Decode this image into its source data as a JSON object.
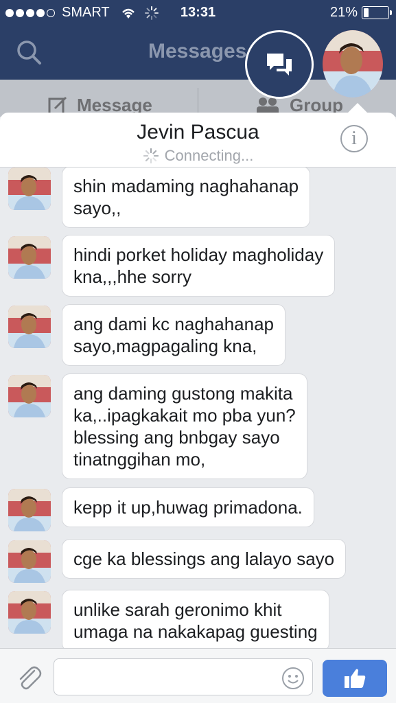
{
  "status_bar": {
    "carrier": "SMART",
    "time": "13:31",
    "battery": "21%",
    "battery_level": 0.21,
    "signal_bars_filled": 4,
    "signal_bars_total": 5
  },
  "nav": {
    "title": "Messages",
    "search_icon": "search-icon"
  },
  "composer": {
    "message_label": "Message",
    "group_label": "Group"
  },
  "chat": {
    "contact_name": "Jevin Pascua",
    "status": "Connecting...",
    "info_icon": "info-icon"
  },
  "messages": [
    {
      "text": "shin madaming naghahanap\nsayo,,"
    },
    {
      "text": "hindi porket holiday magholiday\nkna,,,hhe sorry"
    },
    {
      "text": "ang dami kc naghahanap\nsayo,magpagaling kna,"
    },
    {
      "text": "ang daming gustong makita\nka,..ipagkakait mo pba yun?\nblessing ang bnbgay sayo\ntinatnggihan mo,"
    },
    {
      "text": "kepp it up,huwag primadona."
    },
    {
      "text": "cge ka blessings ang lalayo sayo"
    },
    {
      "text": "unlike sarah geronimo khit\numaga na nakakapag guesting"
    }
  ],
  "input": {
    "placeholder": "",
    "attach_icon": "paperclip-icon",
    "emoji_icon": "smiley-icon",
    "send_icon": "thumbs-up-icon"
  },
  "colors": {
    "nav_bg": "#2b3f67",
    "like_button": "#4a7fdb",
    "chat_bg": "#e9ebee"
  }
}
